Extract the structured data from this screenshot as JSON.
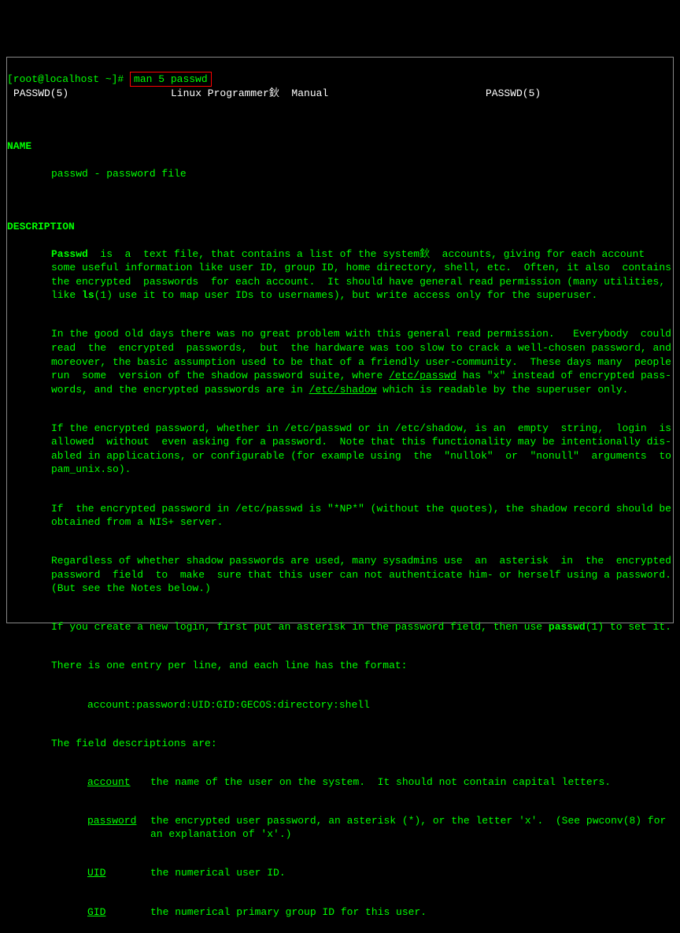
{
  "prompt": "[root@localhost ~]# ",
  "command": "man 5 passwd",
  "header": {
    "left": "PASSWD(5)",
    "center": "Linux Programmer鈥  Manual",
    "right": "PASSWD(5)"
  },
  "sections": {
    "name": {
      "heading": "NAME",
      "text": "passwd - password file"
    },
    "description": {
      "heading": "DESCRIPTION",
      "p1a": "Passwd",
      "p1b": "  is  a  text file, that contains a list of the system鈥  accounts, giving for each account some useful information like user ID, group ID, home directory, shell, etc.  Often, it also  contains  the encrypted  passwords  for each account.  It should have general read permission (many utilities, like ",
      "p1c": "ls",
      "p1d": "(1) use it to map user IDs to usernames), but write access only for the superuser.",
      "p2a": "In the good old days there was no great problem with this general read permission.   Everybody  could read  the  encrypted  passwords,  but  the hardware was too slow to crack a well-chosen password, and moreover, the basic assumption used to be that of a friendly user-community.  These days many  people run  some  version of the shadow password suite, where ",
      "p2b": "/etc/passwd",
      "p2c": " has \"x\" instead of encrypted pass-words, and the encrypted passwords are in ",
      "p2d": "/etc/shadow",
      "p2e": " which is readable by the superuser only.",
      "p3": "If the encrypted password, whether in /etc/passwd or in /etc/shadow, is an  empty  string,  login  is allowed  without  even asking for a password.  Note that this functionality may be intentionally dis-abled in applications, or configurable (for example using  the  \"nullok\"  or  \"nonull\"  arguments  to pam_unix.so).",
      "p4": "If  the encrypted password in /etc/passwd is \"*NP*\" (without the quotes), the shadow record should be obtained from a NIS+ server.",
      "p5": "Regardless of whether shadow passwords are used, many sysadmins use  an  asterisk  in  the  encrypted password  field  to  make  sure that this user can not authenticate him- or herself using a password. (But see the Notes below.)",
      "p6a": "If you create a new login, first put an asterisk in the password field, then use ",
      "p6b": "passwd",
      "p6c": "(1) to set it.",
      "p7": "There is one entry per line, and each line has the format:",
      "format_line": "account:password:UID:GID:GECOS:directory:shell",
      "p8": "The field descriptions are:",
      "fields": {
        "account": {
          "label": "account",
          "desc": "the name of the user on the system.  It should not contain capital letters."
        },
        "password": {
          "label": "password",
          "desc": "the encrypted user password, an asterisk (*), or the letter 'x'.  (See pwconv(8) for an explanation of 'x'.)"
        },
        "uid": {
          "label": "UID",
          "desc": "the numerical user ID."
        },
        "gid": {
          "label": "GID",
          "desc": "the numerical primary group ID for this user."
        }
      }
    }
  }
}
